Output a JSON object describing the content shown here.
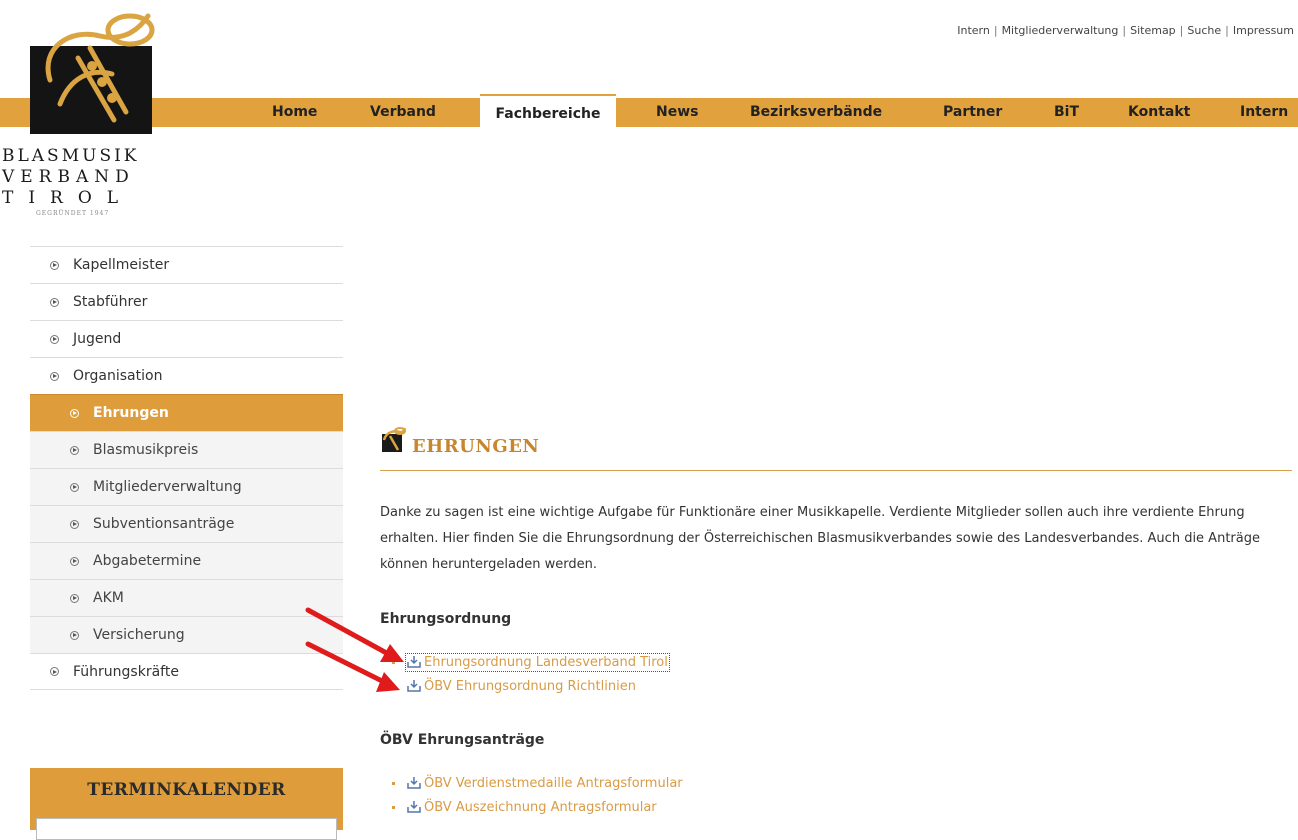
{
  "top_links": [
    "Intern",
    "Mitgliederverwaltung",
    "Sitemap",
    "Suche",
    "Impressum"
  ],
  "brand": {
    "line1": "BLASMUSIK",
    "line2": "VERBAND",
    "line3": "TIROL",
    "tagline": "GEGRÜNDET 1947"
  },
  "nav": {
    "home": "Home",
    "verband": "Verband",
    "fachbereiche": "Fachbereiche",
    "news": "News",
    "bezirksverbaende": "Bezirksverbände",
    "partner": "Partner",
    "bit": "BiT",
    "kontakt": "Kontakt",
    "intern": "Intern",
    "active": "Fachbereiche"
  },
  "sidebar": {
    "items": [
      {
        "label": "Kapellmeister",
        "level": 1
      },
      {
        "label": "Stabführer",
        "level": 1
      },
      {
        "label": "Jugend",
        "level": 1
      },
      {
        "label": "Organisation",
        "level": 1
      },
      {
        "label": "Ehrungen",
        "level": 2,
        "active": true
      },
      {
        "label": "Blasmusikpreis",
        "level": 2
      },
      {
        "label": "Mitgliederverwaltung",
        "level": 2
      },
      {
        "label": "Subventionsanträge",
        "level": 2
      },
      {
        "label": "Abgabetermine",
        "level": 2
      },
      {
        "label": "AKM",
        "level": 2
      },
      {
        "label": "Versicherung",
        "level": 2
      },
      {
        "label": "Führungskräfte",
        "level": 1
      }
    ]
  },
  "termin": {
    "title": "TERMINKALENDER"
  },
  "content": {
    "title": "EHRUNGEN",
    "intro": "Danke zu sagen ist eine wichtige Aufgabe für Funktionäre einer Musikkapelle. Verdiente Mitglieder sollen auch ihre verdiente Ehrung erhalten. Hier finden Sie die Ehrungsordnung der Österreichischen Blasmusikverbandes sowie des Landesverbandes. Auch die Anträge können heruntergeladen werden.",
    "section1": {
      "title": "Ehrungsordnung",
      "links": [
        "Ehrungsordnung Landesverband Tirol",
        "ÖBV Ehrungsordnung Richtlinien"
      ]
    },
    "section2": {
      "title": "ÖBV Ehrungsanträge",
      "links": [
        "ÖBV Verdienstmedaille Antragsformular",
        "ÖBV Auszeichnung Antragsformular"
      ]
    }
  },
  "colors": {
    "accent": "#e1a13c",
    "link": "#d99b45",
    "arrow": "#e01b1b",
    "title": "#c8862c"
  }
}
